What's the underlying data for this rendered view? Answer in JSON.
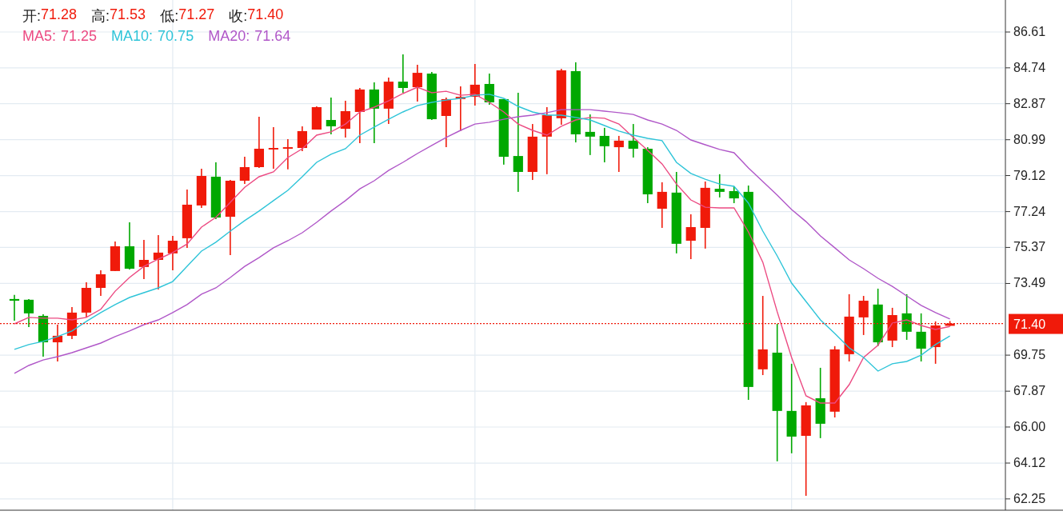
{
  "header": {
    "ohlc": [
      {
        "label": "开:",
        "value": "71.28"
      },
      {
        "label": "高:",
        "value": "71.53"
      },
      {
        "label": "低:",
        "value": "71.27"
      },
      {
        "label": "收:",
        "value": "71.40"
      }
    ],
    "ma_legend": [
      {
        "label": "MA5:",
        "value": "71.25",
        "color": "#ec4a82"
      },
      {
        "label": "MA10:",
        "value": "70.75",
        "color": "#2ec4d8"
      },
      {
        "label": "MA20:",
        "value": "71.64",
        "color": "#b057c8"
      }
    ]
  },
  "chart": {
    "chart_data": {
      "type": "candlestick",
      "grid": true,
      "ylim": [
        61.66,
        88.28
      ],
      "ref_lines": [
        {
          "axis": "y",
          "value": 71.4,
          "label": "71.40",
          "color": "#f01a0a"
        }
      ],
      "yticks": [
        86.61,
        84.74,
        82.87,
        80.99,
        79.12,
        77.24,
        75.37,
        73.49,
        69.75,
        67.87,
        {
          "value": 66,
          "label": "66.00"
        },
        64.12,
        62.25
      ],
      "series": [
        {
          "type": "line",
          "color": "#ec4a82",
          "values": [
            71.38,
            71.72,
            71.68,
            71.68,
            71.59,
            71.72,
            72.14,
            73.09,
            73.8,
            74.38,
            74.76,
            75.1,
            75.55,
            76.43,
            76.94,
            77.72,
            78.51,
            79.06,
            79.31,
            80.06,
            80.52,
            81.23,
            81.4,
            81.81,
            82.44,
            82.69,
            83.02,
            83.4,
            83.73,
            83.44,
            83.52,
            83.31,
            83.36,
            82.94,
            82.44,
            81.81,
            81.48,
            81.23,
            81.69,
            82.02,
            82.15,
            82.11,
            81.81,
            81.11,
            80.44,
            79.73,
            78.68,
            77.85,
            77.47,
            77.43,
            77.43,
            76.18,
            74.6,
            72.01,
            69.63,
            67.63,
            67.25,
            67.25,
            68.21,
            69.63,
            70.26,
            71.42,
            71.59,
            71.3,
            71.09,
            71.25
          ]
        },
        {
          "type": "line",
          "color": "#2ec4d8",
          "values": [
            70.05,
            70.3,
            70.47,
            70.72,
            71.01,
            71.51,
            71.97,
            72.39,
            72.76,
            73.01,
            73.26,
            73.59,
            74.38,
            75.18,
            75.64,
            76.22,
            76.77,
            77.27,
            77.81,
            78.35,
            79.06,
            79.81,
            80.23,
            80.52,
            81.23,
            81.65,
            82.06,
            82.44,
            82.77,
            82.94,
            83.06,
            83.15,
            83.31,
            83.36,
            83.15,
            82.73,
            82.44,
            82.27,
            82.27,
            82.15,
            82.02,
            81.73,
            81.44,
            81.23,
            81.06,
            80.94,
            79.81,
            79.23,
            78.93,
            78.68,
            78.56,
            77.68,
            76.22,
            74.93,
            73.51,
            72.55,
            71.59,
            70.88,
            70.13,
            69.63,
            68.92,
            69.3,
            69.42,
            69.75,
            70.3,
            70.75
          ]
        },
        {
          "type": "line",
          "color": "#b057c8",
          "values": [
            68.8,
            69.21,
            69.5,
            69.67,
            69.88,
            70.13,
            70.38,
            70.72,
            71.01,
            71.34,
            71.59,
            71.97,
            72.39,
            72.93,
            73.26,
            73.8,
            74.38,
            74.84,
            75.35,
            75.72,
            76.14,
            76.68,
            77.27,
            77.81,
            78.43,
            78.85,
            79.39,
            79.81,
            80.27,
            80.69,
            81.11,
            81.48,
            81.81,
            81.9,
            82.06,
            82.19,
            82.27,
            82.4,
            82.56,
            82.56,
            82.56,
            82.48,
            82.4,
            82.31,
            82.02,
            81.81,
            81.48,
            80.98,
            80.73,
            80.48,
            80.31,
            79.52,
            78.81,
            78.1,
            77.35,
            76.72,
            75.97,
            75.35,
            74.72,
            74.26,
            73.76,
            73.34,
            72.84,
            72.35,
            71.97,
            71.64
          ]
        }
      ],
      "ohlc": [
        [
          72.68,
          72.89,
          71.55,
          72.59
        ],
        [
          72.64,
          72.68,
          71.22,
          71.93
        ],
        [
          71.8,
          71.88,
          69.67,
          70.42
        ],
        [
          70.42,
          71.34,
          69.42,
          70.76
        ],
        [
          70.76,
          72.26,
          70.59,
          71.97
        ],
        [
          71.97,
          73.55,
          71.72,
          73.26
        ],
        [
          73.26,
          74.18,
          72.84,
          73.97
        ],
        [
          74.14,
          75.68,
          74.14,
          75.43
        ],
        [
          75.43,
          76.68,
          74.22,
          74.26
        ],
        [
          74.35,
          75.76,
          73.72,
          74.72
        ],
        [
          74.72,
          76.01,
          73.18,
          75.1
        ],
        [
          75.06,
          75.97,
          74.18,
          75.72
        ],
        [
          75.85,
          78.39,
          75.35,
          77.6
        ],
        [
          77.56,
          79.48,
          77.43,
          79.1
        ],
        [
          79.06,
          79.81,
          76.85,
          76.93
        ],
        [
          76.97,
          78.89,
          74.97,
          78.85
        ],
        [
          78.85,
          80.1,
          78.68,
          79.56
        ],
        [
          79.56,
          82.19,
          79.52,
          80.52
        ],
        [
          80.48,
          81.65,
          79.48,
          80.56
        ],
        [
          80.52,
          81.02,
          79.44,
          80.6
        ],
        [
          80.56,
          81.69,
          80.39,
          81.44
        ],
        [
          81.52,
          82.73,
          81.52,
          82.69
        ],
        [
          82.02,
          83.19,
          81.27,
          81.69
        ],
        [
          81.56,
          83.02,
          81.1,
          82.48
        ],
        [
          82.44,
          83.69,
          80.81,
          83.61
        ],
        [
          83.61,
          83.98,
          80.81,
          82.61
        ],
        [
          82.61,
          84.23,
          81.81,
          84.02
        ],
        [
          84.02,
          85.44,
          83.44,
          83.69
        ],
        [
          83.73,
          84.9,
          82.98,
          84.48
        ],
        [
          84.44,
          84.53,
          82.02,
          82.06
        ],
        [
          82.23,
          83.19,
          80.6,
          83.11
        ],
        [
          83.11,
          83.77,
          81.44,
          83.23
        ],
        [
          83.23,
          84.94,
          82.77,
          83.86
        ],
        [
          83.9,
          84.44,
          82.81,
          82.94
        ],
        [
          83.11,
          83.11,
          79.69,
          80.1
        ],
        [
          80.14,
          83.44,
          78.27,
          79.31
        ],
        [
          79.31,
          81.81,
          78.89,
          81.15
        ],
        [
          81.15,
          82.69,
          79.19,
          82.27
        ],
        [
          82.11,
          84.69,
          81.77,
          84.61
        ],
        [
          84.57,
          85.03,
          80.85,
          81.27
        ],
        [
          81.4,
          82.31,
          80.19,
          81.15
        ],
        [
          81.19,
          81.61,
          79.81,
          80.65
        ],
        [
          80.6,
          81.19,
          79.31,
          80.94
        ],
        [
          80.94,
          81.81,
          80.06,
          80.52
        ],
        [
          80.52,
          80.6,
          77.68,
          78.14
        ],
        [
          77.39,
          78.77,
          76.39,
          78.27
        ],
        [
          78.23,
          79.31,
          75.06,
          75.56
        ],
        [
          75.72,
          77.1,
          74.76,
          76.43
        ],
        [
          76.39,
          78.81,
          75.31,
          78.48
        ],
        [
          78.43,
          79.19,
          77.98,
          78.27
        ],
        [
          78.31,
          78.56,
          77.68,
          77.93
        ],
        [
          78.27,
          78.6,
          67.42,
          68.09
        ],
        [
          69.01,
          72.84,
          68.71,
          70.05
        ],
        [
          69.88,
          71.38,
          64.21,
          66.84
        ],
        [
          66.84,
          69.3,
          64.63,
          65.5
        ],
        [
          65.54,
          67.3,
          62.41,
          67.13
        ],
        [
          67.5,
          69.09,
          65.42,
          66.17
        ],
        [
          66.8,
          70.22,
          66.5,
          70.05
        ],
        [
          69.8,
          72.93,
          69.42,
          71.76
        ],
        [
          71.72,
          72.84,
          70.8,
          72.59
        ],
        [
          72.39,
          73.22,
          70.22,
          70.42
        ],
        [
          70.51,
          72.22,
          70.17,
          71.84
        ],
        [
          71.93,
          72.93,
          70.55,
          70.97
        ],
        [
          70.97,
          71.93,
          69.42,
          70.09
        ],
        [
          70.17,
          71.51,
          69.3,
          71.3
        ],
        [
          71.28,
          71.53,
          71.27,
          71.4
        ]
      ]
    }
  }
}
